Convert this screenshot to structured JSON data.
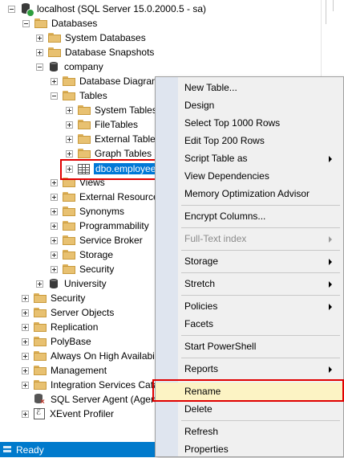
{
  "tree": {
    "server": "localhost (SQL Server 15.0.2000.5 - sa)",
    "databases": "Databases",
    "system_databases": "System Databases",
    "database_snapshots": "Database Snapshots",
    "company": "company",
    "database_diagrams": "Database Diagrams",
    "tables": "Tables",
    "system_tables": "System Tables",
    "filetables": "FileTables",
    "external_tables": "External Tables",
    "graph_tables": "Graph Tables",
    "dbo_employee": "dbo.employee",
    "views": "Views",
    "external_resources": "External Resources",
    "synonyms": "Synonyms",
    "programmability": "Programmability",
    "service_broker": "Service Broker",
    "storage": "Storage",
    "security_db": "Security",
    "university": "University",
    "security": "Security",
    "server_objects": "Server Objects",
    "replication": "Replication",
    "polybase": "PolyBase",
    "always_on": "Always On High Availability",
    "management": "Management",
    "integration_services": "Integration Services Catalogs",
    "sql_agent": "SQL Server Agent (Agent XPs disabled)",
    "xevent_profiler": "XEvent Profiler"
  },
  "context_menu": {
    "new_table": "New Table...",
    "design": "Design",
    "select_top": "Select Top 1000 Rows",
    "edit_top": "Edit Top 200 Rows",
    "script_table_as": "Script Table as",
    "view_dependencies": "View Dependencies",
    "memory_optimization": "Memory Optimization Advisor",
    "encrypt_columns": "Encrypt Columns...",
    "full_text_index": "Full-Text index",
    "storage": "Storage",
    "stretch": "Stretch",
    "policies": "Policies",
    "facets": "Facets",
    "start_powershell": "Start PowerShell",
    "reports": "Reports",
    "rename": "Rename",
    "delete": "Delete",
    "refresh": "Refresh",
    "properties": "Properties"
  },
  "status": {
    "text": "Ready"
  },
  "colors": {
    "selection": "#0078d7",
    "highlight_box": "#e00000",
    "status_bar": "#007acc",
    "hover": "#fcf3c4"
  }
}
